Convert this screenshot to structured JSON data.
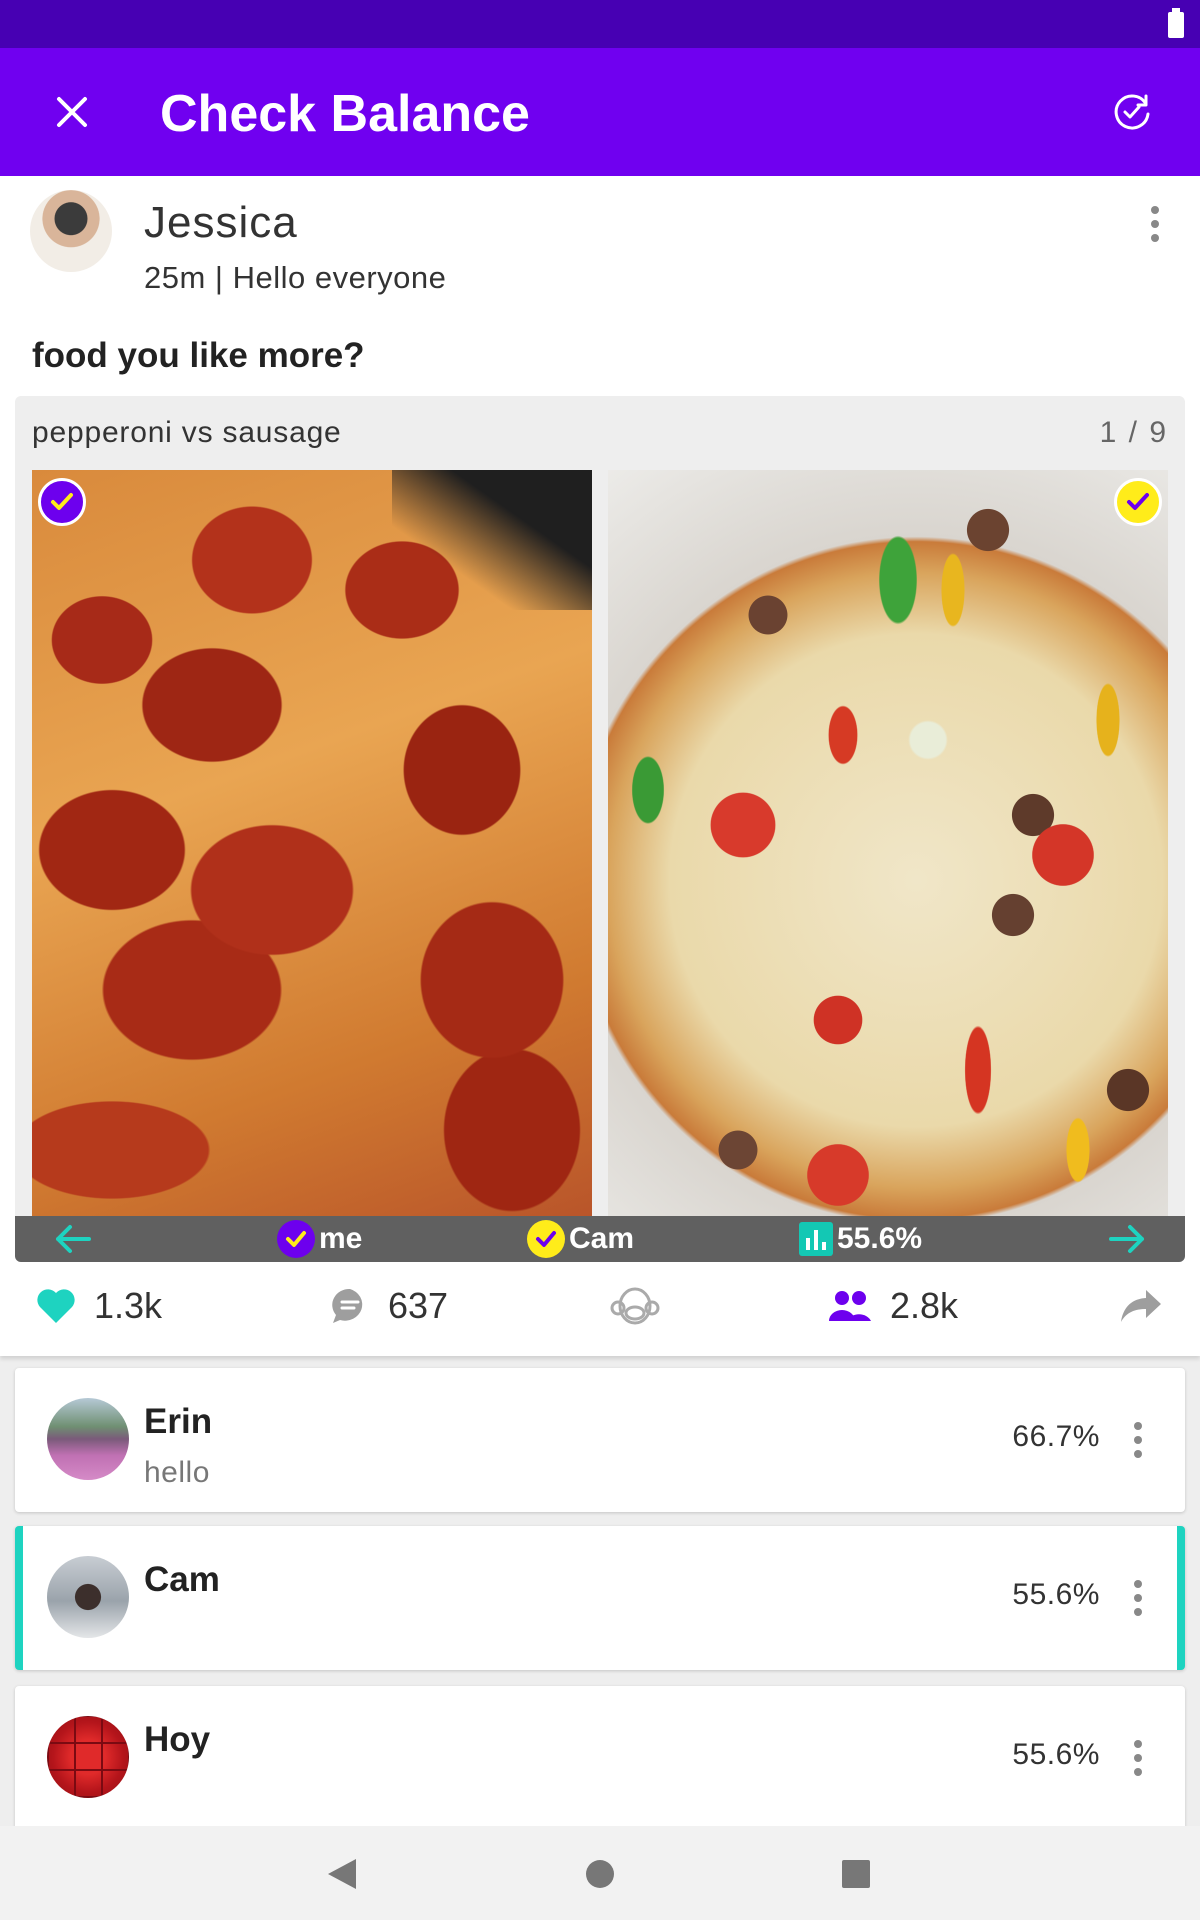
{
  "app_bar": {
    "title": "Check Balance",
    "close_icon": "close-icon",
    "refresh_icon": "refresh-check-icon",
    "background": "#7000f0"
  },
  "colors": {
    "status_bar": "#4700b3",
    "accent_purple": "#6d00ee",
    "accent_yellow": "#ffec1a",
    "accent_teal": "#1ed3c0"
  },
  "post": {
    "author": "Jessica",
    "meta": "25m | Hello everyone",
    "question": "food you like more?",
    "poll": {
      "title": "pepperoni vs sausage",
      "counter": "1 / 9",
      "choices": [
        {
          "image": "pepperoni-pizza-photo",
          "check_color": "purple"
        },
        {
          "image": "vegetable-sausage-pizza-photo",
          "check_color": "yellow"
        }
      ],
      "legend": {
        "me": "me",
        "cam": "Cam",
        "percent": "55.6%"
      }
    },
    "actions": {
      "likes": "1.3k",
      "comments": "637",
      "voters": "2.8k"
    }
  },
  "comments": [
    {
      "name": "Erin",
      "text": "hello",
      "percent": "66.7%",
      "highlighted": false
    },
    {
      "name": "Cam",
      "text": "",
      "percent": "55.6%",
      "highlighted": true
    },
    {
      "name": "Hoy",
      "text": "",
      "percent": "55.6%",
      "highlighted": false
    }
  ],
  "nav_bar": {
    "buttons": [
      "back-icon",
      "home-icon",
      "recents-icon"
    ]
  }
}
